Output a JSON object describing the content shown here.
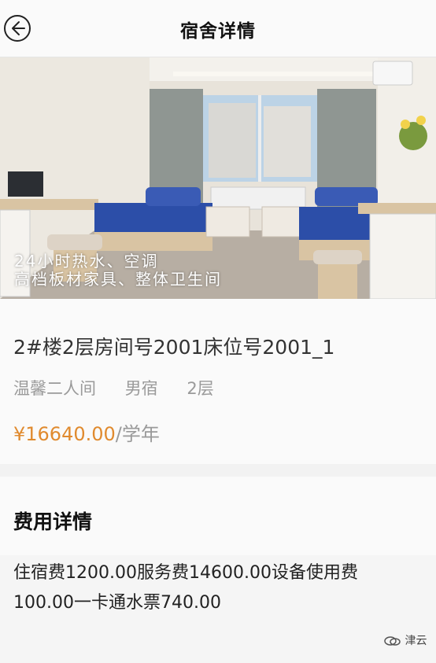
{
  "header": {
    "title": "宿舍详情"
  },
  "photo": {
    "overlay_line1": "24小时热水、空调",
    "overlay_line2": "高档板材家具、整体卫生间"
  },
  "room": {
    "title": "2#楼2层房间号2001床位号2001_1",
    "type": "温馨二人间",
    "gender": "男宿",
    "floor": "2层",
    "price": "¥16640.00",
    "price_unit": "/学年"
  },
  "fees": {
    "title": "费用详情",
    "line1": "住宿费1200.00服务费14600.00设备使用费",
    "line2": "100.00一卡通水票740.00"
  },
  "watermark": {
    "text": "津云"
  },
  "colors": {
    "price": "#e08a2e",
    "muted": "#9a9a9a"
  }
}
